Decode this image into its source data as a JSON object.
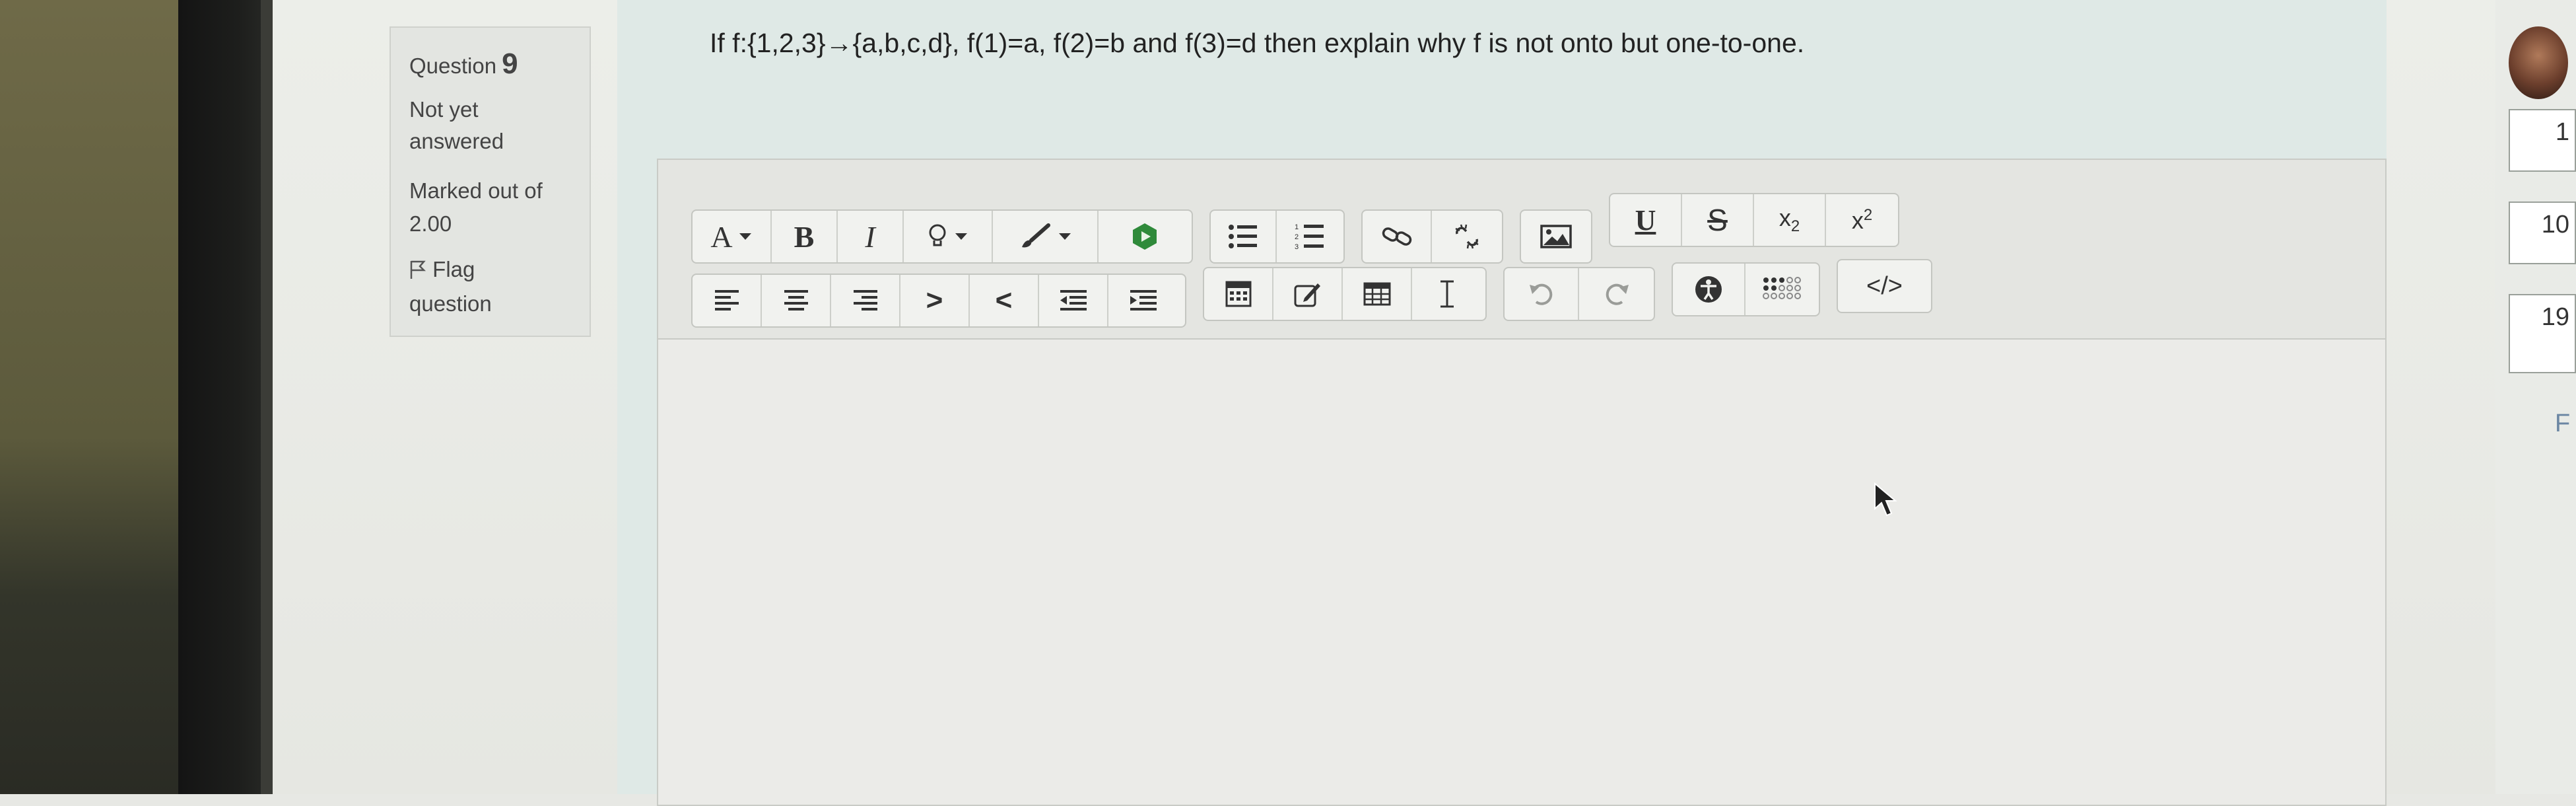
{
  "question": {
    "label": "Question",
    "number": "9",
    "status": "Not yet answered",
    "marked": "Marked out of 2.00",
    "flag": "Flag question",
    "text": "If f:{1,2,3}→{a,b,c,d}, f(1)=a, f(2)=b and f(3)=d then explain why f is not onto but  one-to-one."
  },
  "editor": {
    "toolbar_row1": {
      "font_size": "A",
      "bold": "B",
      "italic": "I",
      "underline": "U",
      "strikethrough": "S",
      "subscript_base": "x",
      "subscript_sub": "2",
      "superscript_base": "x",
      "superscript_sup": "2"
    },
    "toolbar_row2": {
      "indent_right": ">",
      "indent_left": "<",
      "html": "</>"
    },
    "content": ""
  },
  "nav": {
    "box1": "1",
    "box2": "10",
    "box3": "19",
    "partial": "F"
  },
  "colors": {
    "accent_green": "#2f8a3a",
    "text": "#222222"
  },
  "icons": [
    "font-size-icon",
    "bold-icon",
    "italic-icon",
    "lightbulb-icon",
    "brush-icon",
    "recordrtc-icon",
    "unordered-list-icon",
    "ordered-list-icon",
    "link-icon",
    "unlink-icon",
    "image-icon",
    "underline-icon",
    "strikethrough-icon",
    "subscript-icon",
    "superscript-icon",
    "align-left-icon",
    "align-center-icon",
    "align-right-icon",
    "indent-icon",
    "outdent-icon",
    "numbered-indent-icon",
    "bulleted-indent-icon",
    "equation-icon",
    "edit-icon",
    "table-icon",
    "clear-format-icon",
    "undo-icon",
    "redo-icon",
    "accessibility-icon",
    "special-chars-icon",
    "html-icon"
  ]
}
